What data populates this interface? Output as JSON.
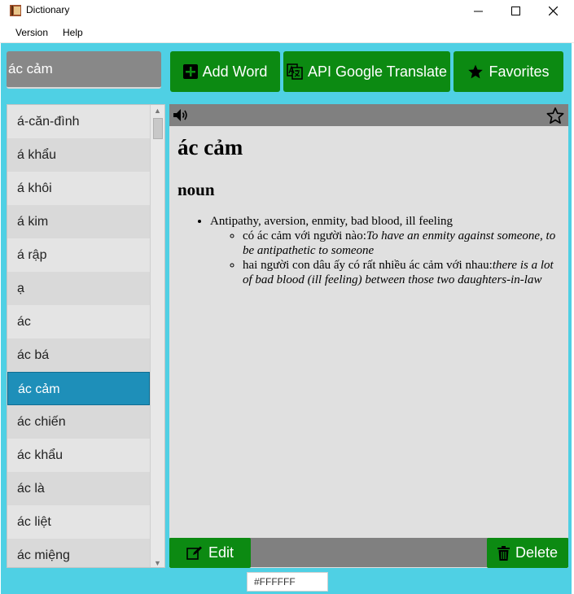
{
  "window": {
    "title": "Dictionary"
  },
  "menu": {
    "items": [
      "Version",
      "Help"
    ]
  },
  "search": {
    "value": "ác cảm"
  },
  "toolbar": {
    "add_word": "Add Word",
    "api_translate": "API Google Translate",
    "favorites": "Favorites"
  },
  "word_list": {
    "items": [
      "á-căn-đình",
      "á khẩu",
      "á khôi",
      "á kim",
      "á rập",
      "ạ",
      "ác",
      "ác bá",
      "ác cảm",
      "ác chiến",
      "ác khẩu",
      "ác là",
      "ác liệt",
      "ác miệng"
    ],
    "selected": "ác cảm"
  },
  "definition": {
    "word": "ác cảm",
    "part_of_speech": "noun",
    "meaning": "Antipathy, aversion, enmity, bad blood, ill feeling",
    "examples": [
      {
        "vi": "có ác cảm với người nào:",
        "en": "To have an enmity against someone, to be antipathetic to someone"
      },
      {
        "vi": "hai người con dâu ấy có rất nhiều ác cảm với nhau:",
        "en": "there is a lot of bad blood (ill feeling) between those two daughters-in-law"
      }
    ]
  },
  "actions": {
    "edit": "Edit",
    "delete": "Delete"
  },
  "color_picker": {
    "value": "#FFFFFF"
  },
  "colors": {
    "accent": "#4fd0e4",
    "button_green": "#0c8a12",
    "selected_row": "#1e8fb9"
  }
}
